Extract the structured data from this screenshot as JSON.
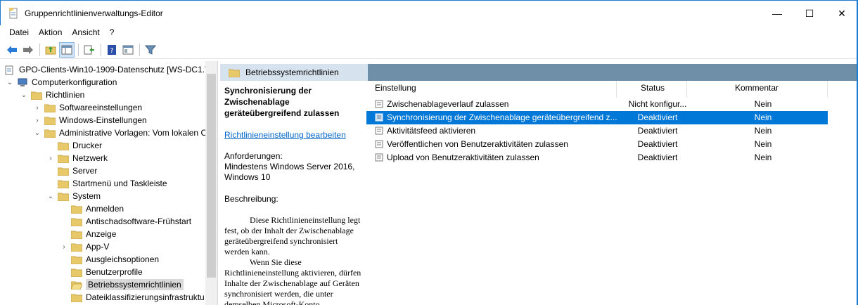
{
  "window": {
    "title": "Gruppenrichtlinienverwaltungs-Editor",
    "minimize": "—",
    "maximize": "☐",
    "close": "✕"
  },
  "menu": [
    "Datei",
    "Aktion",
    "Ansicht",
    "?"
  ],
  "tree": {
    "root": "GPO-Clients-Win10-1909-Datenschutz [WS-DC1.V",
    "items": [
      "Computerkonfiguration",
      "Richtlinien",
      "Softwareeinstellungen",
      "Windows-Einstellungen",
      "Administrative Vorlagen: Vom lokalen C",
      "Drucker",
      "Netzwerk",
      "Server",
      "Startmenü und Taskleiste",
      "System",
      "Anmelden",
      "Antischadsoftware-Frühstart",
      "Anzeige",
      "App-V",
      "Ausgleichsoptionen",
      "Benutzerprofile",
      "Betriebssystemrichtlinien",
      "Dateiklassifizierungsinfrastruktu"
    ]
  },
  "header": {
    "title": "Betriebssystemrichtlinien"
  },
  "description": {
    "title": "Synchronisierung der Zwischenablage geräteübergreifend zulassen",
    "link": "Richtlinieneinstellung bearbeiten",
    "requirements_label": "Anforderungen:",
    "requirements_text": "Mindestens Windows Server 2016, Windows 10",
    "description_label": "Beschreibung:",
    "description_text_1": "Diese Richtlinieneinstellung legt fest, ob der Inhalt der Zwischenablage geräteübergreifend synchronisiert werden kann.",
    "description_text_2": "Wenn Sie diese Richtlinieneinstellung aktivieren, dürfen Inhalte der Zwischenablage auf Geräten synchronisiert werden, die unter demselben Microsoft-Konto"
  },
  "list": {
    "columns": [
      "Einstellung",
      "Status",
      "Kommentar"
    ],
    "rows": [
      {
        "name": "Zwischenablageverlauf zulassen",
        "status": "Nicht konfigur...",
        "comment": "Nein"
      },
      {
        "name": "Synchronisierung der Zwischenablage geräteübergreifend z...",
        "status": "Deaktiviert",
        "comment": "Nein"
      },
      {
        "name": "Aktivitätsfeed aktivieren",
        "status": "Deaktiviert",
        "comment": "Nein"
      },
      {
        "name": "Veröffentlichen von Benutzeraktivitäten zulassen",
        "status": "Deaktiviert",
        "comment": "Nein"
      },
      {
        "name": "Upload von Benutzeraktivitäten zulassen",
        "status": "Deaktiviert",
        "comment": "Nein"
      }
    ]
  },
  "colors": {
    "accent": "#0078d7",
    "header_strip": "#6f8ea8",
    "folder": "#e8c96a"
  }
}
